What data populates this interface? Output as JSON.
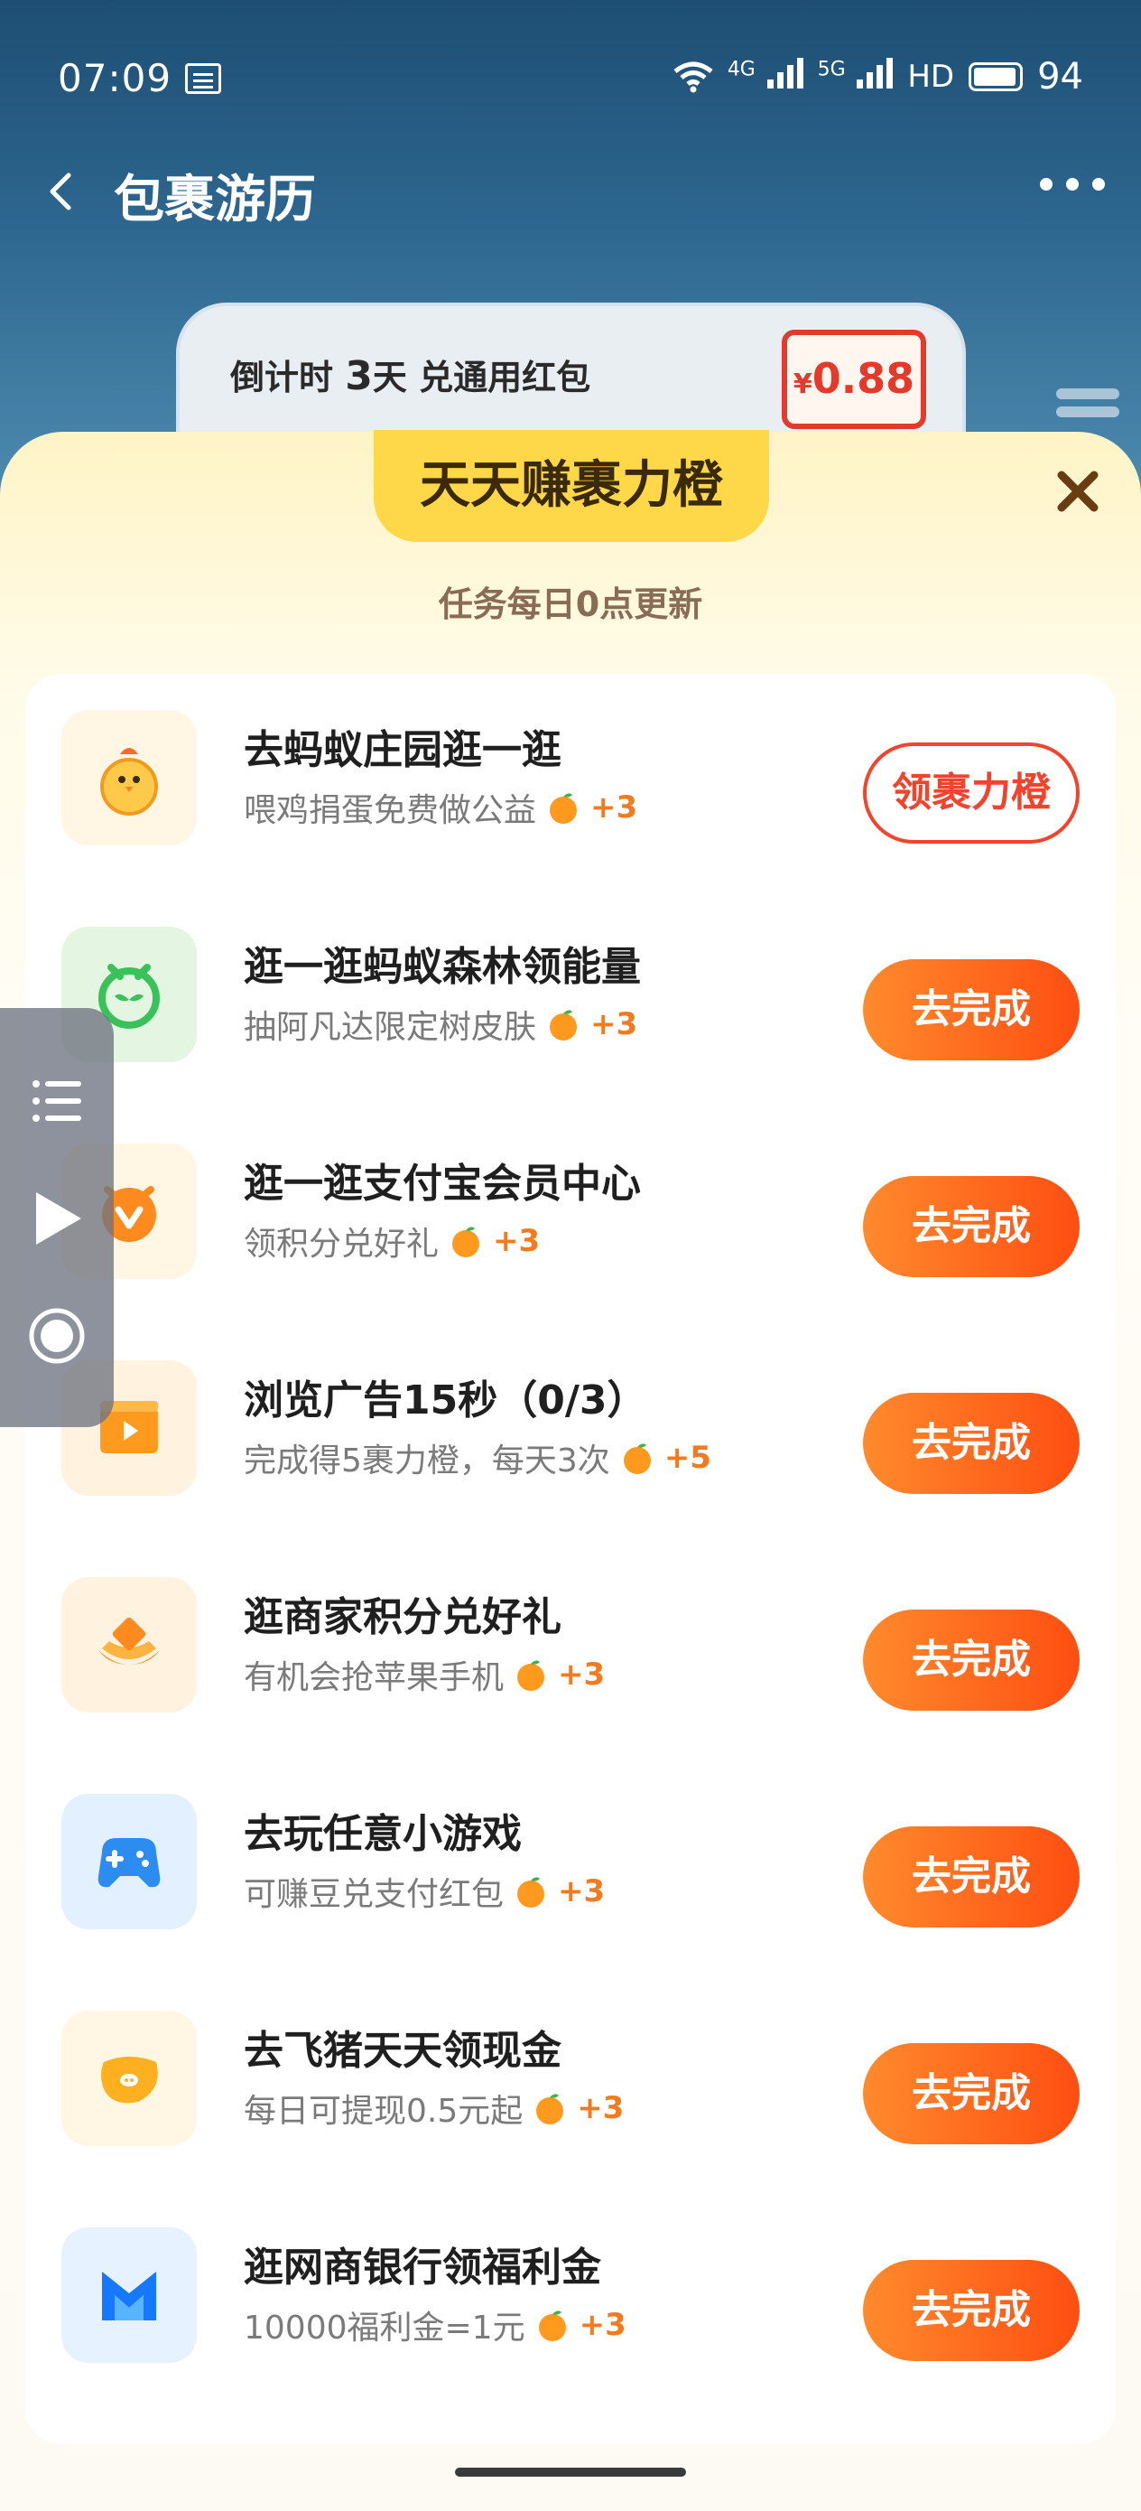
{
  "status_bar": {
    "time": "07:09",
    "net_4g": "4G",
    "net_5g": "5G",
    "hd": "HD",
    "battery": "94"
  },
  "nav": {
    "title": "包裹游历"
  },
  "countdown": {
    "prefix": "倒计时",
    "days": "3",
    "suffix": "天 兑通用红包",
    "amount_symbol": "¥",
    "amount": "0.88"
  },
  "sheet": {
    "tab_title": "天天赚裹力橙",
    "subtitle": "任务每日0点更新"
  },
  "tasks": [
    {
      "title": "去蚂蚁庄园逛一逛",
      "desc": "喂鸡捐蛋免费做公益",
      "reward": "+3",
      "button": "领裹力橙",
      "icon": "chick-icon"
    },
    {
      "title": "逛一逛蚂蚁森林领能量",
      "desc": "抽阿凡达限定树皮肤",
      "reward": "+3",
      "button": "去完成",
      "icon": "sprout-icon"
    },
    {
      "title": "逛一逛支付宝会员中心",
      "desc": "领积分兑好礼",
      "reward": "+3",
      "button": "去完成",
      "icon": "member-badge-icon"
    },
    {
      "title": "浏览广告15秒（0/3）",
      "desc": "完成得5裹力橙，每天3次",
      "reward": "+5",
      "button": "去完成",
      "icon": "video-ad-icon"
    },
    {
      "title": "逛商家积分兑好礼",
      "desc": "有机会抢苹果手机",
      "reward": "+3",
      "button": "去完成",
      "icon": "gift-ingot-icon"
    },
    {
      "title": "去玩任意小游戏",
      "desc": "可赚豆兑支付红包",
      "reward": "+3",
      "button": "去完成",
      "icon": "gamepad-icon"
    },
    {
      "title": "去飞猪天天领现金",
      "desc": "每日可提现0.5元起",
      "reward": "+3",
      "button": "去完成",
      "icon": "fliggy-pig-icon"
    },
    {
      "title": "逛网商银行领福利金",
      "desc": "10000福利金=1元",
      "reward": "+3",
      "button": "去完成",
      "icon": "mybank-icon"
    }
  ],
  "colors": {
    "accent_orange": "#ff5a18",
    "reward_orange": "#f27b20",
    "tab_yellow": "#ffd84a"
  }
}
